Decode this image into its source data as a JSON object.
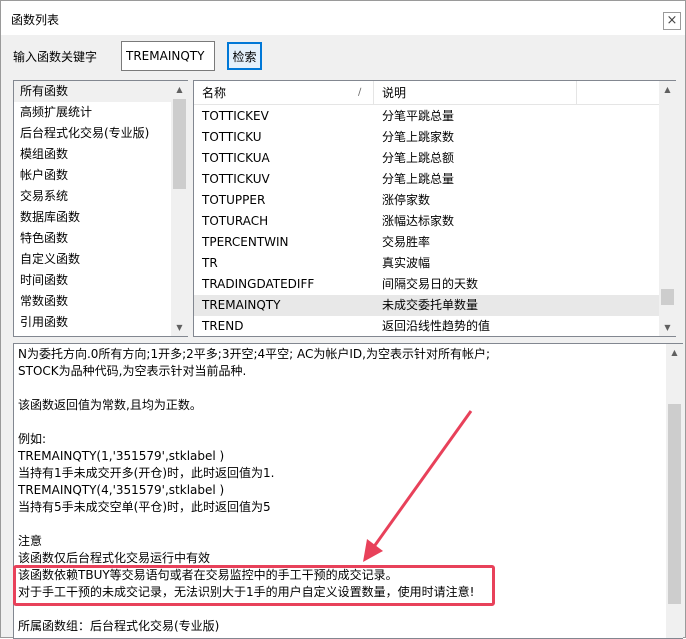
{
  "window": {
    "title": "函数列表",
    "close_glyph": "×"
  },
  "search": {
    "label": "输入函数关键字",
    "value": "TREMAINQTY",
    "button_label": "检索"
  },
  "categories": {
    "items": [
      {
        "label": "所有函数"
      },
      {
        "label": "高频扩展统计"
      },
      {
        "label": "后台程式化交易(专业版)"
      },
      {
        "label": "模组函数"
      },
      {
        "label": "帐户函数"
      },
      {
        "label": "交易系统"
      },
      {
        "label": "数据库函数"
      },
      {
        "label": "特色函数"
      },
      {
        "label": "自定义函数"
      },
      {
        "label": "时间函数"
      },
      {
        "label": "常数函数"
      },
      {
        "label": "引用函数"
      }
    ],
    "selected": "所有函数"
  },
  "function_table": {
    "columns": [
      "名称",
      "说明"
    ],
    "sort_glyph": "∕",
    "rows": [
      {
        "name": "TOTTICKEV",
        "desc": "分笔平跳总量"
      },
      {
        "name": "TOTTICKU",
        "desc": "分笔上跳家数"
      },
      {
        "name": "TOTTICKUA",
        "desc": "分笔上跳总额"
      },
      {
        "name": "TOTTICKUV",
        "desc": "分笔上跳总量"
      },
      {
        "name": "TOTUPPER",
        "desc": "涨停家数"
      },
      {
        "name": "TOTURACH",
        "desc": "涨幅达标家数"
      },
      {
        "name": "TPERCENTWIN",
        "desc": "交易胜率"
      },
      {
        "name": "TR",
        "desc": "真实波幅"
      },
      {
        "name": "TRADINGDATEDIFF",
        "desc": "间隔交易日的天数"
      },
      {
        "name": "TREMAINQTY",
        "desc": "未成交委托单数量"
      },
      {
        "name": "TREND",
        "desc": "返回沿线性趋势的值"
      }
    ],
    "selected": "TREMAINQTY"
  },
  "description": {
    "lines": [
      "N为委托方向.0所有方向;1开多;2平多;3开空;4平空; AC为帐户ID,为空表示针对所有帐户;",
      "STOCK为品种代码,为空表示针对当前品种.",
      "",
      "该函数返回值为常数,且均为正数。",
      "",
      "例如:",
      "TREMAINQTY(1,'351579',stklabel )",
      "当持有1手未成交开多(开仓)时，此时返回值为1.",
      "TREMAINQTY(4,'351579',stklabel )",
      "当持有5手未成交空单(平仓)时，此时返回值为5",
      "",
      "注意",
      "该函数仅后台程式化交易运行中有效",
      "该函数依赖TBUY等交易语句或者在交易监控中的手工干预的成交记录。",
      "对于手工干预的未成交记录，无法识别大于1手的用户自定义设置数量，使用时请注意!",
      "",
      "所属函数组：后台程式化交易(专业版)"
    ]
  },
  "annotation": {
    "color": "#e8415a"
  }
}
